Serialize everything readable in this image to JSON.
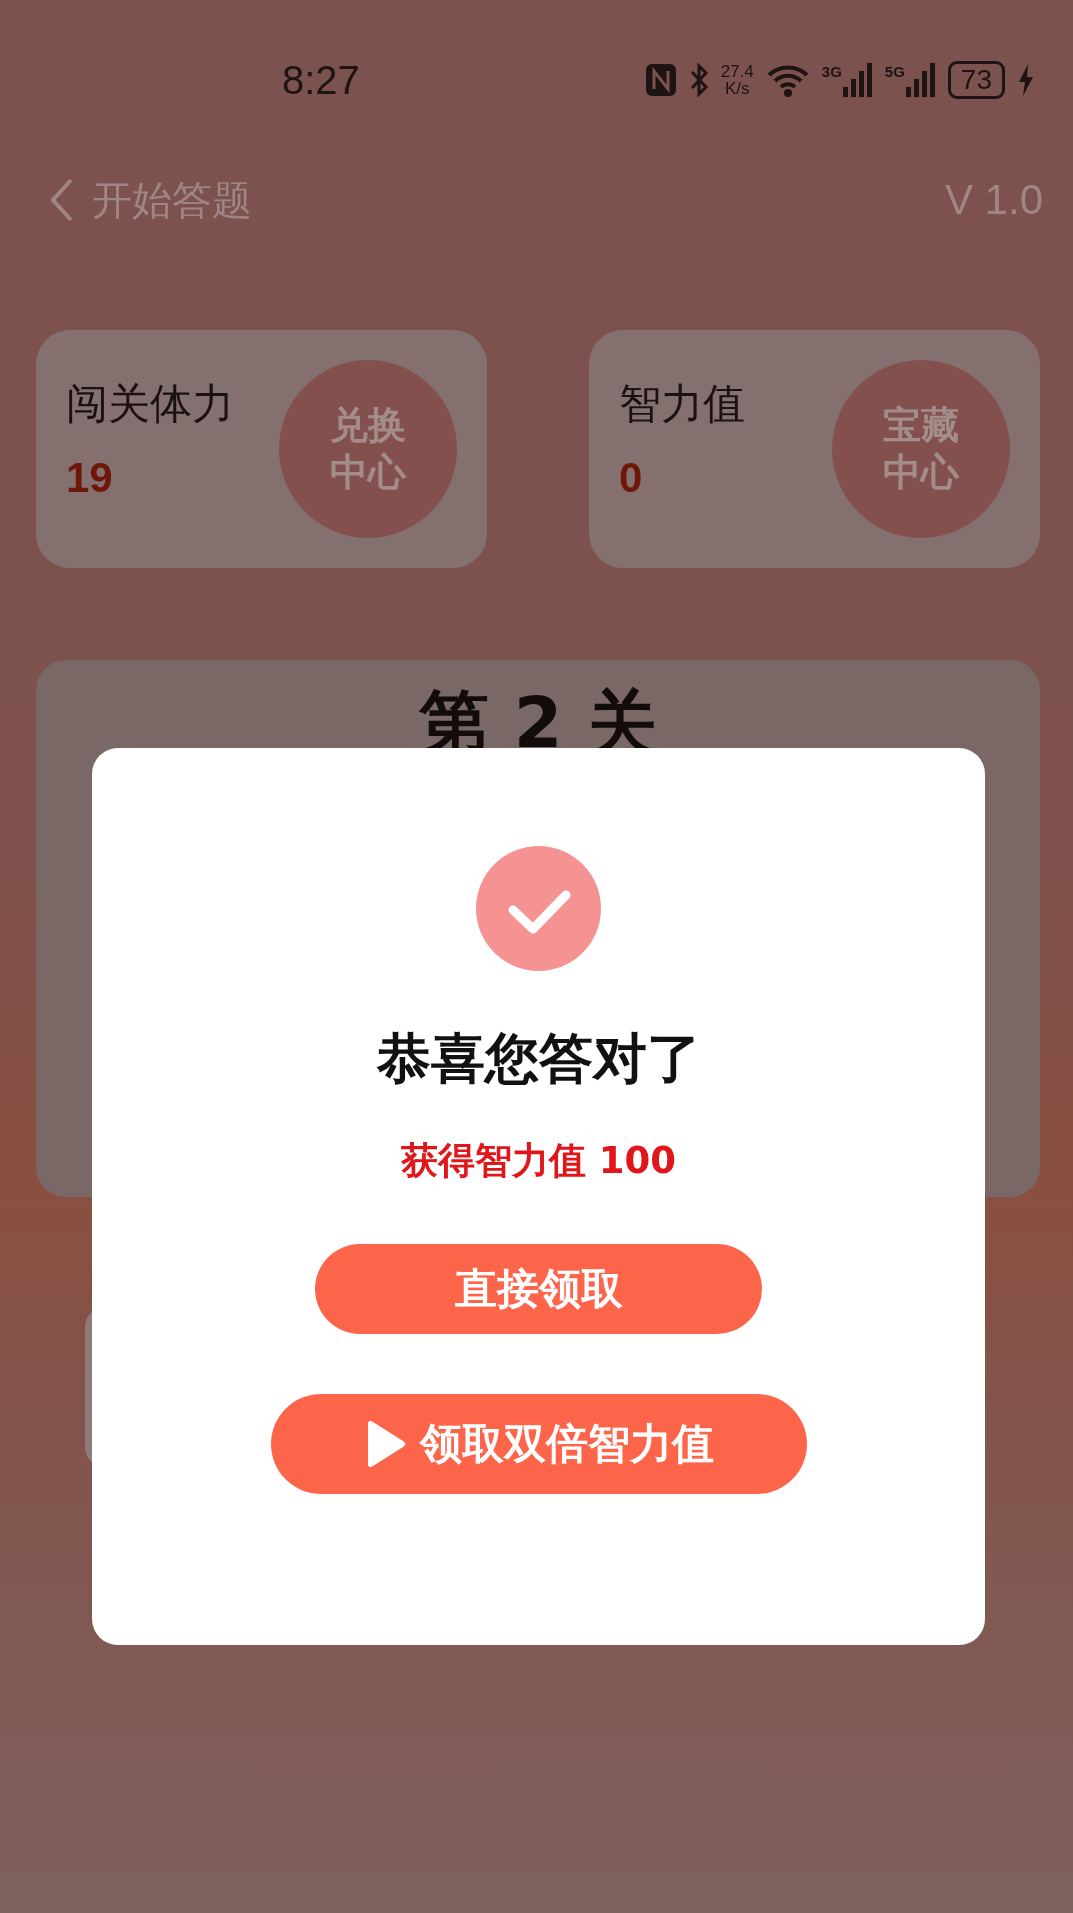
{
  "status_bar": {
    "time": "8:27",
    "net_speed": "27.4",
    "net_speed_unit": "K/s",
    "signals": [
      {
        "label": "3G"
      },
      {
        "label": "5G"
      }
    ],
    "battery": "73",
    "charging": true
  },
  "header": {
    "title": "开始答题",
    "version": "V 1.0"
  },
  "stats": [
    {
      "label": "闯关体力",
      "value": "19",
      "action": "兑换中心"
    },
    {
      "label": "智力值",
      "value": "0",
      "action": "宝藏中心"
    }
  ],
  "level": {
    "title": "第 2 关"
  },
  "dialog": {
    "title": "恭喜您答对了",
    "reward": "获得智力值 100",
    "buttons": [
      {
        "label": "直接领取",
        "kind": "plain"
      },
      {
        "label": "领取双倍智力值",
        "kind": "video"
      }
    ]
  }
}
